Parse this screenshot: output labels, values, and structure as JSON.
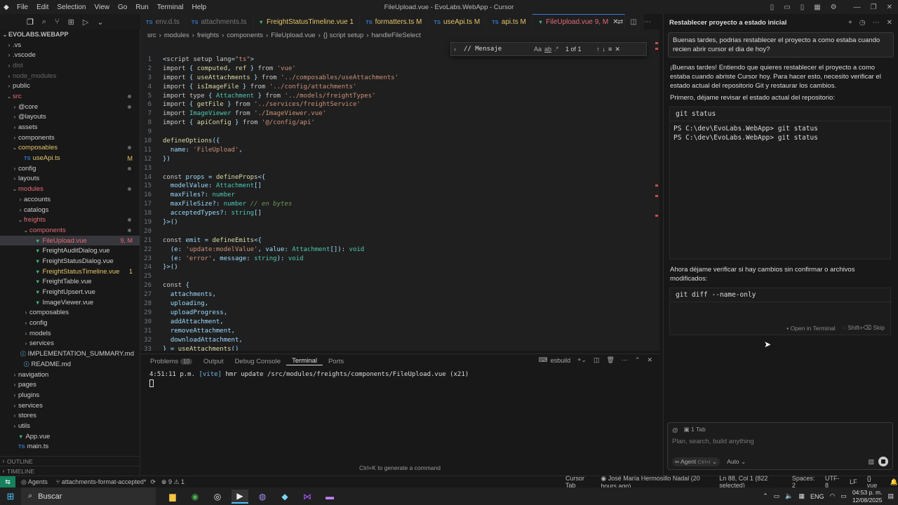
{
  "window": {
    "title": "FileUpload.vue - EvoLabs.WebApp - Cursor",
    "menu": [
      "File",
      "Edit",
      "Selection",
      "View",
      "Go",
      "Run",
      "Terminal",
      "Help"
    ]
  },
  "sidebar": {
    "root": "EVOLABS.WEBAPP",
    "items": [
      {
        "label": ".vs",
        "depth": 1,
        "type": "folder"
      },
      {
        "label": ".vscode",
        "depth": 1,
        "type": "folder"
      },
      {
        "label": "dist",
        "depth": 1,
        "type": "folder",
        "dim": true
      },
      {
        "label": "node_modules",
        "depth": 1,
        "type": "folder",
        "dim": true
      },
      {
        "label": "public",
        "depth": 1,
        "type": "folder"
      },
      {
        "label": "src",
        "depth": 1,
        "type": "folder-open",
        "color": "#e06c75",
        "dot": true
      },
      {
        "label": "@core",
        "depth": 2,
        "type": "folder",
        "dot": true
      },
      {
        "label": "@layouts",
        "depth": 2,
        "type": "folder"
      },
      {
        "label": "assets",
        "depth": 2,
        "type": "folder"
      },
      {
        "label": "components",
        "depth": 2,
        "type": "folder"
      },
      {
        "label": "composables",
        "depth": 2,
        "type": "folder-open",
        "color": "#e4c46a",
        "dot": true
      },
      {
        "label": "useApi.ts",
        "depth": 3,
        "type": "ts",
        "color": "#e4c46a",
        "badge": "M"
      },
      {
        "label": "config",
        "depth": 2,
        "type": "folder",
        "dot": true
      },
      {
        "label": "layouts",
        "depth": 2,
        "type": "folder"
      },
      {
        "label": "modules",
        "depth": 2,
        "type": "folder-open",
        "color": "#e06c75",
        "dot": true
      },
      {
        "label": "accounts",
        "depth": 3,
        "type": "folder"
      },
      {
        "label": "catalogs",
        "depth": 3,
        "type": "folder"
      },
      {
        "label": "freights",
        "depth": 3,
        "type": "folder-open",
        "color": "#e06c75",
        "dot": true
      },
      {
        "label": "components",
        "depth": 4,
        "type": "folder-open",
        "color": "#e06c75",
        "dot": true
      },
      {
        "label": "FileUpload.vue",
        "depth": 5,
        "type": "vue",
        "color": "#e06c75",
        "badge": "9, M",
        "selected": true
      },
      {
        "label": "FreightAuditDialog.vue",
        "depth": 5,
        "type": "vue"
      },
      {
        "label": "FreightStatusDialog.vue",
        "depth": 5,
        "type": "vue"
      },
      {
        "label": "FreightStatusTimeline.vue",
        "depth": 5,
        "type": "vue",
        "color": "#e4c46a",
        "badge": "1"
      },
      {
        "label": "FreightTable.vue",
        "depth": 5,
        "type": "vue"
      },
      {
        "label": "FreightUpsert.vue",
        "depth": 5,
        "type": "vue"
      },
      {
        "label": "ImageViewer.vue",
        "depth": 5,
        "type": "vue"
      },
      {
        "label": "composables",
        "depth": 4,
        "type": "folder"
      },
      {
        "label": "config",
        "depth": 4,
        "type": "folder"
      },
      {
        "label": "models",
        "depth": 4,
        "type": "folder"
      },
      {
        "label": "services",
        "depth": 4,
        "type": "folder"
      },
      {
        "label": "IMPLEMENTATION_SUMMARY.md",
        "depth": 3,
        "type": "md"
      },
      {
        "label": "README.md",
        "depth": 3,
        "type": "md"
      },
      {
        "label": "navigation",
        "depth": 2,
        "type": "folder"
      },
      {
        "label": "pages",
        "depth": 2,
        "type": "folder"
      },
      {
        "label": "plugins",
        "depth": 2,
        "type": "folder"
      },
      {
        "label": "services",
        "depth": 2,
        "type": "folder"
      },
      {
        "label": "stores",
        "depth": 2,
        "type": "folder"
      },
      {
        "label": "utils",
        "depth": 2,
        "type": "folder"
      },
      {
        "label": "App.vue",
        "depth": 2,
        "type": "vue"
      },
      {
        "label": "main.ts",
        "depth": 2,
        "type": "ts"
      }
    ],
    "outline": "OUTLINE",
    "timeline": "TIMELINE"
  },
  "tabs": [
    {
      "label": "env.d.ts",
      "icon": "TS",
      "color": "#777"
    },
    {
      "label": "attachments.ts",
      "icon": "TS",
      "color": "#777"
    },
    {
      "label": "FreightStatusTimeline.vue 1",
      "icon": "V",
      "color": "#e4c46a"
    },
    {
      "label": "formatters.ts M",
      "icon": "TS",
      "color": "#e4c46a"
    },
    {
      "label": "useApi.ts M",
      "icon": "TS",
      "color": "#e4c46a"
    },
    {
      "label": "api.ts M",
      "icon": "TS",
      "color": "#e4c46a"
    },
    {
      "label": "FileUpload.vue 9, M",
      "icon": "V",
      "color": "#e06c75",
      "active": true
    }
  ],
  "breadcrumb": [
    "src",
    "modules",
    "freights",
    "components",
    "FileUpload.vue",
    "{} script setup",
    "handleFileSelect"
  ],
  "find": {
    "query": "// Mensaje",
    "result": "1 of 1",
    "opts": [
      "Aa",
      "ab",
      ".*"
    ]
  },
  "code": [
    {
      "n": "1",
      "t": "<script setup lang=\"ts\">"
    },
    {
      "n": "2",
      "t": "import { computed, ref } from 'vue'"
    },
    {
      "n": "3",
      "t": "import { useAttachments } from '../composables/useAttachments'"
    },
    {
      "n": "4",
      "t": "import { isImageFile } from '../config/attachments'"
    },
    {
      "n": "5",
      "t": "import type { Attachment } from '../models/freightTypes'"
    },
    {
      "n": "6",
      "t": "import { getFile } from '../services/freightService'"
    },
    {
      "n": "7",
      "t": "import ImageViewer from './ImageViewer.vue'"
    },
    {
      "n": "8",
      "t": "import { apiConfig } from '@/config/api'"
    },
    {
      "n": "9",
      "t": ""
    },
    {
      "n": "10",
      "t": "defineOptions({"
    },
    {
      "n": "11",
      "t": "  name: 'FileUpload',"
    },
    {
      "n": "12",
      "t": "})"
    },
    {
      "n": "13",
      "t": ""
    },
    {
      "n": "14",
      "t": "const props = defineProps<{"
    },
    {
      "n": "15",
      "t": "  modelValue: Attachment[]"
    },
    {
      "n": "16",
      "t": "  maxFiles?: number"
    },
    {
      "n": "17",
      "t": "  maxFileSize?: number // en bytes"
    },
    {
      "n": "18",
      "t": "  acceptedTypes?: string[]"
    },
    {
      "n": "19",
      "t": "}>()"
    },
    {
      "n": "20",
      "t": ""
    },
    {
      "n": "21",
      "t": "const emit = defineEmits<{"
    },
    {
      "n": "22",
      "t": "  (e: 'update:modelValue', value: Attachment[]): void"
    },
    {
      "n": "23",
      "t": "  (e: 'error', message: string): void"
    },
    {
      "n": "24",
      "t": "}>()"
    },
    {
      "n": "25",
      "t": ""
    },
    {
      "n": "26",
      "t": "const {"
    },
    {
      "n": "27",
      "t": "  attachments,"
    },
    {
      "n": "28",
      "t": "  uploading,"
    },
    {
      "n": "29",
      "t": "  uploadProgress,"
    },
    {
      "n": "30",
      "t": "  addAttachment,"
    },
    {
      "n": "31",
      "t": "  removeAttachment,"
    },
    {
      "n": "32",
      "t": "  downloadAttachment,"
    },
    {
      "n": "33",
      "t": "} = useAttachments()"
    }
  ],
  "panel": {
    "tabs": [
      {
        "label": "Problems",
        "badge": "10"
      },
      {
        "label": "Output"
      },
      {
        "label": "Debug Console"
      },
      {
        "label": "Terminal",
        "active": true
      },
      {
        "label": "Ports"
      }
    ],
    "shell": "esbuild",
    "line1_time": "4:51:11 p.m.",
    "line1_tag": "[vite]",
    "line1_msg": "hmr update /src/modules/freights/components/FileUpload.vue (x21)"
  },
  "cmdhint": "Ctrl+K to generate a command",
  "chat": {
    "title": "Restablecer proyecto a estado inicial",
    "user_msg": "Buenas tardes, podrias restablecer el proyecto a como estaba cuando recien abrir cursor el dia de hoy?",
    "reply1": "¡Buenas tardes! Entiendo que quieres restablecer el proyecto a como estaba cuando abriste Cursor hoy. Para hacer esto, necesito verificar el estado actual del repositorio Git y restaurar los cambios.",
    "reply2": "Primero, déjame revisar el estado actual del repositorio:",
    "cmd1": "git status",
    "out1": "PS C:\\dev\\EvoLabs.WebApp> git status",
    "out2": "PS C:\\dev\\EvoLabs.WebApp> git status",
    "reply3": "Ahora déjame verificar si hay cambios sin confirmar o archivos modificados:",
    "cmd2": "git diff --name-only",
    "open_terminal": "Open in Terminal",
    "skip": "Shift+⌫ Skip",
    "context": "1 Tab",
    "input_placeholder": "Plan, search, build anything",
    "agent": "Agent",
    "agent_shortcut": "Ctrl+I",
    "auto": "Auto"
  },
  "statusbar": {
    "agents": "Agents",
    "branch": "attachments-format-accepted*",
    "errors": "9",
    "warnings": "1",
    "cursor_tab": "Cursor Tab",
    "blame": "José María Hermosillo Nadal (20 hours ago)",
    "position": "Ln 88, Col 1 (822 selected)",
    "spaces": "Spaces: 2",
    "encoding": "UTF-8",
    "eol": "LF",
    "lang": "vue"
  },
  "taskbar": {
    "search": "Buscar",
    "lang": "ENG",
    "time": "04:53 p. m.",
    "date": "12/08/2025"
  }
}
